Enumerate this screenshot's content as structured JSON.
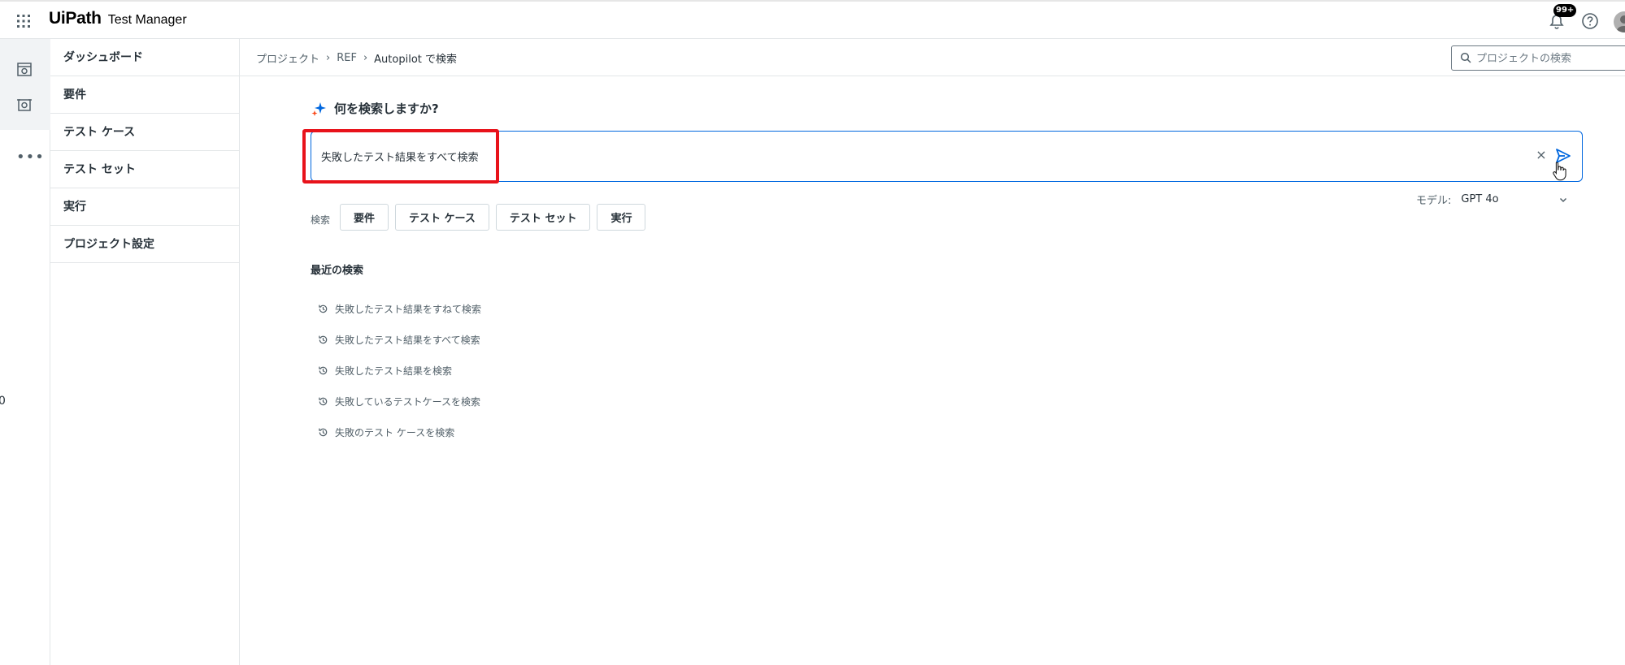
{
  "header": {
    "brand_logo": "UiPath",
    "app_name": "Test Manager",
    "notification_badge": "99+"
  },
  "nav": {
    "items": [
      {
        "label": "ダッシュボード"
      },
      {
        "label": "要件"
      },
      {
        "label": "テスト ケース"
      },
      {
        "label": "テスト セット"
      },
      {
        "label": "実行"
      },
      {
        "label": "プロジェクト設定"
      }
    ]
  },
  "rail": {
    "more": "•••",
    "edge_mark": "0"
  },
  "breadcrumb": {
    "root": "プロジェクト",
    "project": "REF",
    "current": "Autopilot で検索",
    "separator": "›"
  },
  "project_search": {
    "placeholder": "プロジェクトの検索"
  },
  "search": {
    "heading": "何を検索しますか?",
    "query_value": "失敗したテスト結果をすべて検索",
    "clear_label": "×"
  },
  "model": {
    "label": "モデル:",
    "value": "GPT 4o"
  },
  "filters": {
    "label": "検索",
    "chips": [
      "要件",
      "テスト ケース",
      "テスト セット",
      "実行"
    ]
  },
  "recent": {
    "title": "最近の検索",
    "items": [
      "失敗したテスト結果をすねて検索",
      "失敗したテスト結果をすべて検索",
      "失敗したテスト結果を検索",
      "失敗しているテストケースを検索",
      "失敗のテスト ケースを検索"
    ]
  },
  "colors": {
    "accent": "#0067df",
    "highlight": "#e8121a",
    "brand_dot": "#fa4616"
  }
}
